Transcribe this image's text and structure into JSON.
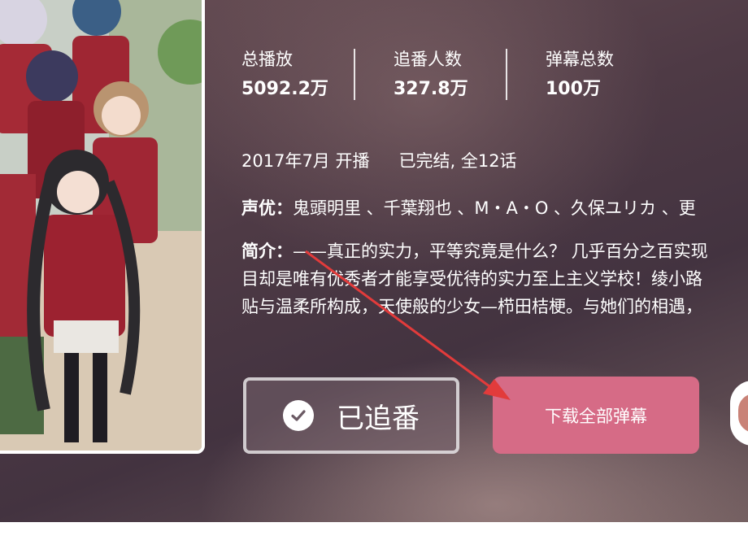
{
  "stats": [
    {
      "label": "总播放",
      "value": "5092.2万"
    },
    {
      "label": "追番人数",
      "value": "327.8万"
    },
    {
      "label": "弹幕总数",
      "value": "100万"
    }
  ],
  "premiere": "2017年7月 开播",
  "status": "已完结, 全12话",
  "cast": {
    "label": "声优：",
    "value": "鬼頭明里 、千葉翔也 、M・A・O 、久保ユリカ 、更"
  },
  "intro": {
    "label": "简介：",
    "lines": [
      "——真正的实力，平等究竟是什么？ 几乎百分之百实现",
      "目却是唯有优秀者才能享受优待的实力至上主义学校！绫小路",
      "贴与温柔所构成，天使般的少女—栉田桔梗。与她们的相遇，"
    ]
  },
  "buttons": {
    "follow": "已追番",
    "download": "下载全部弹幕"
  },
  "colors": {
    "download_button": "#d66b86",
    "annotation_arrow": "#e23b3b"
  },
  "icons": {
    "follow_check": "check-icon",
    "annotation": "arrow-annotation"
  }
}
